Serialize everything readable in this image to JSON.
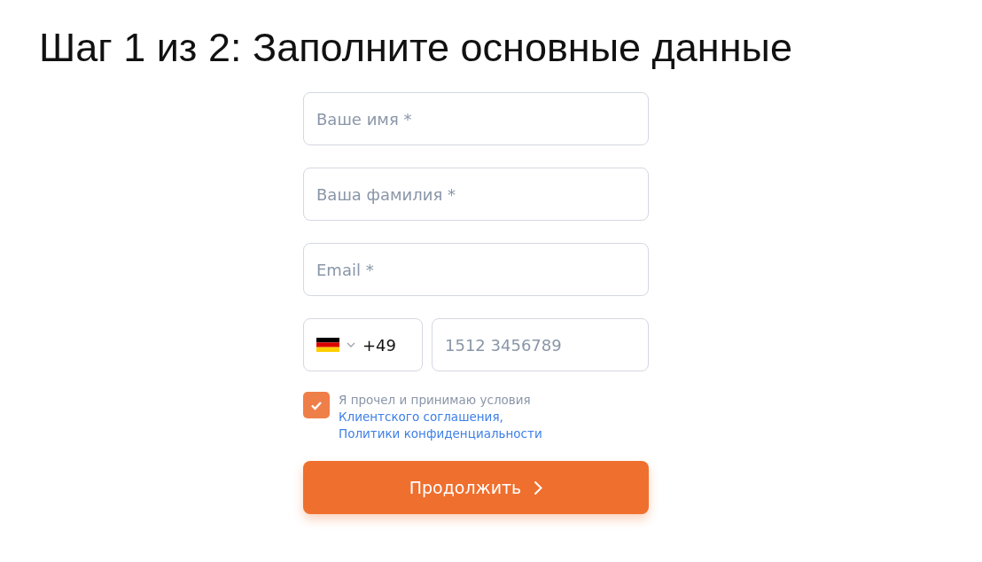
{
  "title": "Шаг 1 из 2: Заполните основные данные",
  "fields": [
    {
      "placeholder": "Ваше имя *"
    },
    {
      "placeholder": "Ваша фамилия *"
    },
    {
      "placeholder": "Email *"
    }
  ],
  "phone": {
    "country_code": "+49",
    "placeholder": "1512 3456789"
  },
  "agreement": {
    "checked": true,
    "text": "Я прочел и принимаю условия",
    "links": [
      "Клиентского соглашения,",
      "Политики конфиденциальности"
    ]
  },
  "submit": {
    "label": "Продолжить"
  }
}
